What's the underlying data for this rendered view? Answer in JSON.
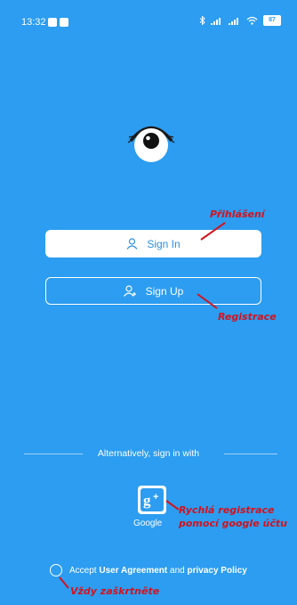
{
  "status_bar": {
    "time": "13:32",
    "battery": "87",
    "icons": [
      "bluetooth-icon",
      "signal-icon",
      "signal-icon",
      "wifi-icon",
      "battery-icon"
    ]
  },
  "logo": {
    "icon": "eye-logo-icon"
  },
  "buttons": {
    "sign_in_label": "Sign In",
    "sign_up_label": "Sign Up"
  },
  "alternative": {
    "label": "Alternatively, sign in with",
    "google_label": "Google",
    "google_icon": "google-plus-icon"
  },
  "agreement": {
    "prefix": "Accept ",
    "user_agreement": "User Agreement",
    "and": " and ",
    "privacy_policy": "privacy Policy"
  },
  "annotations": {
    "sign_in": "Přihlášení",
    "sign_up": "Registrace",
    "google_line1": "Rychlá registrace",
    "google_line2": "pomocí google účtu",
    "checkbox": "Vždy zaškrtněte"
  },
  "colors": {
    "background": "#2c9df0",
    "annotation": "#d3131e",
    "button_text": "#2c8fdd"
  }
}
